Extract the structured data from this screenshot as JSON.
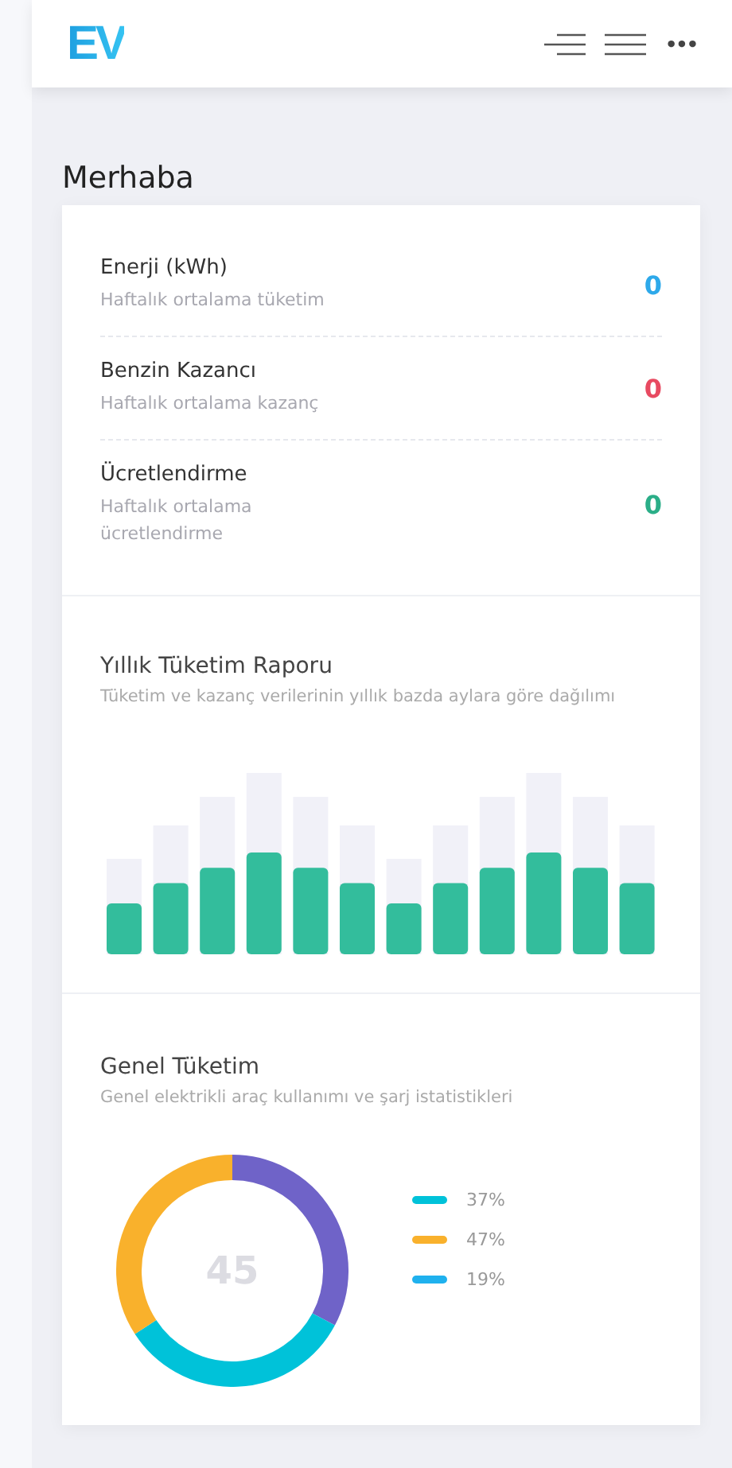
{
  "header": {
    "logo": "EV",
    "more": "•••"
  },
  "greeting": "Merhaba",
  "stats": [
    {
      "title": "Enerji (kWh)",
      "subtitle": "Haftalık ortalama tüketim",
      "value": "0",
      "color": "#2ea9ea"
    },
    {
      "title": "Benzin Kazancı",
      "subtitle": "Haftalık ortalama kazanç",
      "value": "0",
      "color": "#e84a61"
    },
    {
      "title": "Ücretlendirme",
      "subtitle": "Haftalık ortalama ücretlendirme",
      "value": "0",
      "color": "#2bae88"
    }
  ],
  "yearly_report": {
    "title": "Yıllık Tüketim Raporu",
    "subtitle": "Tüketim ve kazanç verilerinin yıllık bazda aylara göre dağılımı"
  },
  "general": {
    "title": "Genel Tüketim",
    "subtitle": "Genel elektrikli araç kullanımı ve şarj istatistikleri",
    "center": "45",
    "legend": [
      {
        "label": "37%",
        "color": "#00c2d9"
      },
      {
        "label": "47%",
        "color": "#f9b12c"
      },
      {
        "label": "19%",
        "color": "#1fb1ee"
      }
    ]
  }
}
